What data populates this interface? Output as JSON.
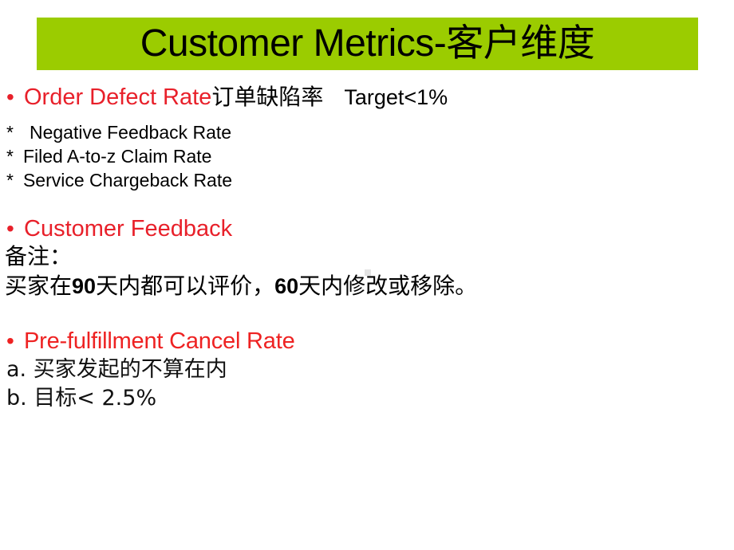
{
  "slide": {
    "background_color": "#FFFFFF",
    "title": {
      "banner_color": "#9BCC00",
      "text_en": "Customer Metrics-",
      "text_cjk": "客户维度",
      "text_color": "#000000"
    },
    "accent_red": "#E8202A",
    "sections": [
      {
        "id": "order-defect-rate",
        "bullet": "•",
        "heading_red": "Order Defect Rate",
        "heading_cjk": "订单缺陷率",
        "heading_target": "Target<1%",
        "sub_items": [
          {
            "marker": "*",
            "label": "Negative Feedback Rate"
          },
          {
            "marker": "*",
            "label": "Filed A-to-z Claim Rate"
          },
          {
            "marker": "*",
            "label": "Service Chargeback Rate"
          }
        ]
      },
      {
        "id": "customer-feedback",
        "bullet": "•",
        "heading_red": "Customer Feedback",
        "notes": [
          "备注：",
          "买家在90天内都可以评价，60天内修改或移除。"
        ],
        "note_line2_parts": {
          "p1": "买家在",
          "n1": "90",
          "p2": "天内都可以评价，",
          "n2": "60",
          "p3": "天内修改或移除。"
        }
      },
      {
        "id": "pre-fulfillment-cancel-rate",
        "bullet": "•",
        "heading_red": "Pre-fulfillment Cancel Rate",
        "items": [
          "a. 买家发起的不算在内",
          "b. 目标< 2.5%"
        ]
      }
    ]
  }
}
